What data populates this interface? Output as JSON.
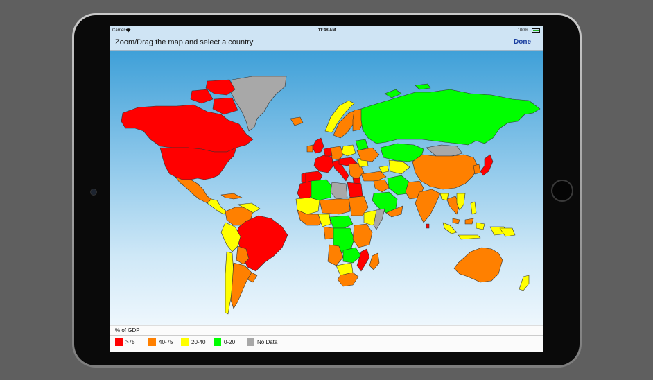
{
  "status_bar": {
    "carrier": "Carrier",
    "wifi_icon": "wifi-icon",
    "time": "11:48 AM",
    "battery": "100%",
    "battery_icon": "battery-icon"
  },
  "nav_bar": {
    "title": "Zoom/Drag the map and select a country",
    "done_label": "Done"
  },
  "map": {
    "type": "choropleth world map",
    "sea_color_top": "#3fa0d8",
    "sea_color_bottom": "#eef7fd",
    "category_colors": {
      ">75": "#ff0000",
      "40-75": "#ff8000",
      "20-40": "#ffff00",
      "0-20": "#00ff00",
      "No Data": "#a8a8a8"
    }
  },
  "legend": {
    "title": "% of GDP",
    "items": [
      {
        "label": ">75",
        "color": "#ff0000"
      },
      {
        "label": "40-75",
        "color": "#ff8000"
      },
      {
        "label": "20-40",
        "color": "#ffff00"
      },
      {
        "label": "0-20",
        "color": "#00ff00"
      },
      {
        "label": "No Data",
        "color": "#a8a8a8"
      }
    ]
  }
}
